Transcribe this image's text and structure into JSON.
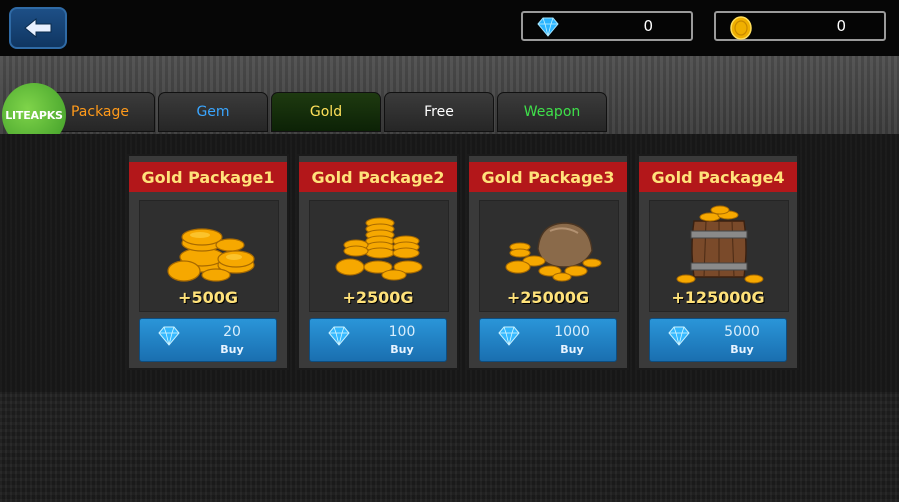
{
  "topbar": {
    "gem_count": "0",
    "gold_count": "0"
  },
  "watermark": {
    "text": "LITEAPKS"
  },
  "tabs": [
    {
      "label": "Package",
      "color": "#ff9a1a",
      "active": false
    },
    {
      "label": "Gem",
      "color": "#3aa6ff",
      "active": false
    },
    {
      "label": "Gold",
      "color": "#ffe15a",
      "active": true
    },
    {
      "label": "Free",
      "color": "#ffffff",
      "active": false
    },
    {
      "label": "Weapon",
      "color": "#3fe04a",
      "active": false
    }
  ],
  "packages": [
    {
      "title": "Gold Package1",
      "amount": "+500G",
      "price": "20",
      "buy_label": "Buy",
      "image": "coin-pile-icon"
    },
    {
      "title": "Gold Package2",
      "amount": "+2500G",
      "price": "100",
      "buy_label": "Buy",
      "image": "coin-stacks-icon"
    },
    {
      "title": "Gold Package3",
      "amount": "+25000G",
      "price": "1000",
      "buy_label": "Buy",
      "image": "coin-sack-icon"
    },
    {
      "title": "Gold Package4",
      "amount": "+125000G",
      "price": "5000",
      "buy_label": "Buy",
      "image": "coin-barrel-icon"
    }
  ],
  "colors": {
    "title_bar": "#b3171a",
    "gold_text": "#ffe27a",
    "buy_button": "#1f82c6"
  }
}
